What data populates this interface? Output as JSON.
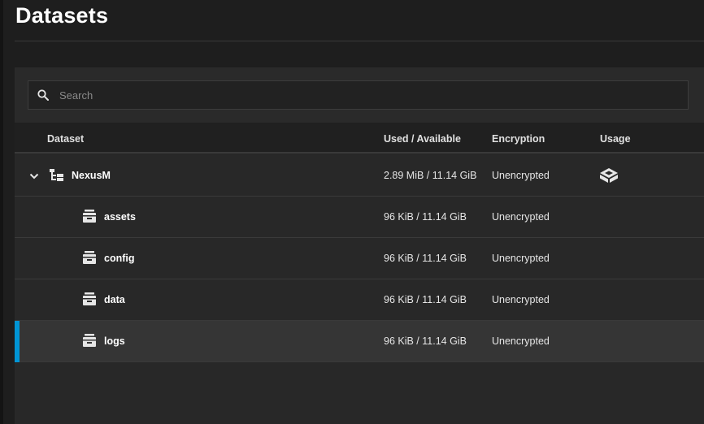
{
  "page": {
    "title": "Datasets"
  },
  "search": {
    "placeholder": "Search",
    "value": ""
  },
  "table": {
    "columns": {
      "dataset": "Dataset",
      "used_available": "Used / Available",
      "encryption": "Encryption",
      "usage": "Usage"
    },
    "rows": [
      {
        "name": "NexusM",
        "used_available": "2.89 MiB / 11.14 GiB",
        "encryption": "Unencrypted",
        "expanded": true,
        "type": "pool",
        "usage_icon": "usage-icon"
      },
      {
        "name": "assets",
        "used_available": "96 KiB / 11.14 GiB",
        "encryption": "Unencrypted",
        "type": "dataset"
      },
      {
        "name": "config",
        "used_available": "96 KiB / 11.14 GiB",
        "encryption": "Unencrypted",
        "type": "dataset"
      },
      {
        "name": "data",
        "used_available": "96 KiB / 11.14 GiB",
        "encryption": "Unencrypted",
        "type": "dataset"
      },
      {
        "name": "logs",
        "used_available": "96 KiB / 11.14 GiB",
        "encryption": "Unencrypted",
        "type": "dataset",
        "selected": true
      }
    ]
  },
  "colors": {
    "accent": "#0095d5",
    "background": "#1e1e1e",
    "panel": "#282828",
    "selected_row": "#353535"
  }
}
